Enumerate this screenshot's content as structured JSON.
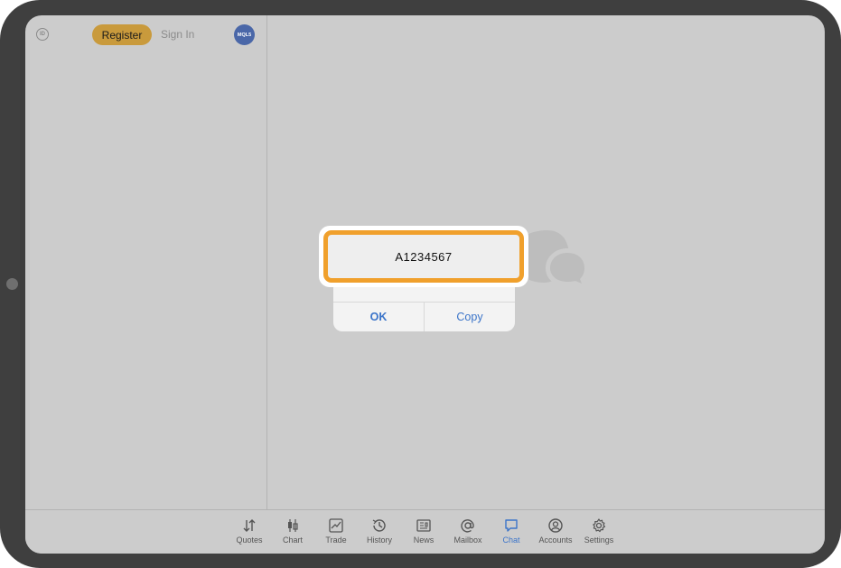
{
  "sidebar": {
    "id_icon": "id-icon",
    "id_icon_text": "ID",
    "register_label": "Register",
    "signin_label": "Sign In",
    "mql_badge_text": "MQL5"
  },
  "dialog": {
    "account_code": "A1234567",
    "ok_label": "OK",
    "copy_label": "Copy"
  },
  "tabs": [
    {
      "label": "Quotes",
      "icon": "arrows-updown-icon"
    },
    {
      "label": "Chart",
      "icon": "candlestick-icon"
    },
    {
      "label": "Trade",
      "icon": "trend-chart-icon"
    },
    {
      "label": "History",
      "icon": "history-icon"
    },
    {
      "label": "News",
      "icon": "news-icon"
    },
    {
      "label": "Mailbox",
      "icon": "at-icon"
    },
    {
      "label": "Chat",
      "icon": "chat-bubble-icon",
      "active": true
    },
    {
      "label": "Accounts",
      "icon": "account-icon"
    },
    {
      "label": "Settings",
      "icon": "gear-icon"
    }
  ],
  "colors": {
    "accent": "#3b74c9",
    "register": "#c99a3c",
    "highlight": "#f0a02c",
    "mql_badge": "#4a67a8"
  }
}
